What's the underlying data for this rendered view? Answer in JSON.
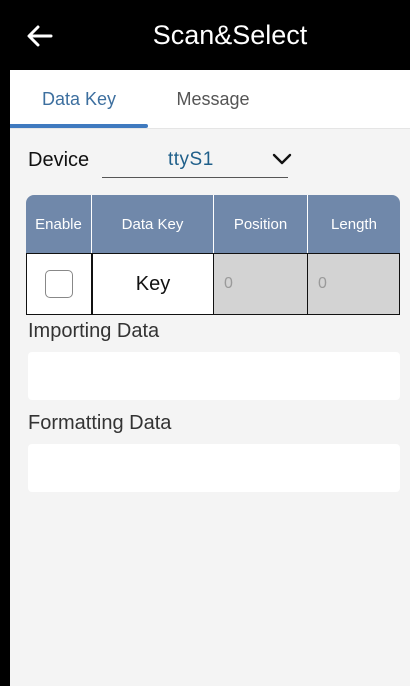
{
  "header": {
    "title": "Scan&Select",
    "back_icon": "arrow-left-icon"
  },
  "tabs": [
    {
      "label": "Data Key",
      "active": true
    },
    {
      "label": "Message",
      "active": false
    }
  ],
  "device": {
    "label": "Device",
    "value": "ttyS1",
    "dropdown_icon": "chevron-down-icon"
  },
  "table": {
    "headers": {
      "enable": "Enable",
      "data_key": "Data Key",
      "position": "Position",
      "length": "Length"
    },
    "row": {
      "enabled": false,
      "key": "Key",
      "position": "0",
      "length": "0"
    }
  },
  "importing": {
    "label": "Importing Data",
    "value": ""
  },
  "formatting": {
    "label": "Formatting Data",
    "value": ""
  },
  "colors": {
    "accent": "#3f7abf",
    "header_bg": "#7088aa",
    "topbar_bg": "#000000",
    "device_value": "#1f5f8a"
  }
}
